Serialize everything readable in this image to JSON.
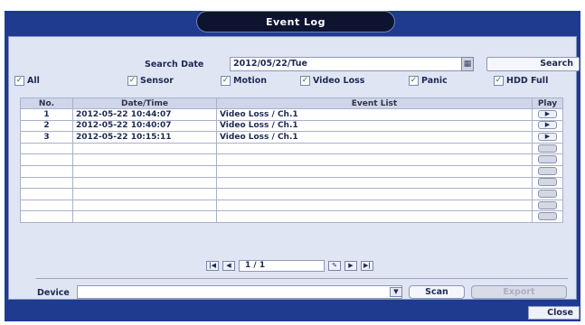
{
  "window": {
    "title": "Event Log"
  },
  "search": {
    "label": "Search Date",
    "date_value": "2012/05/22/Tue",
    "button_label": "Search",
    "calendar_icon": "calendar-icon"
  },
  "filters": [
    {
      "label": "All",
      "checked": true
    },
    {
      "label": "Sensor",
      "checked": true
    },
    {
      "label": "Motion",
      "checked": true
    },
    {
      "label": "Video Loss",
      "checked": true
    },
    {
      "label": "Panic",
      "checked": true
    },
    {
      "label": "HDD Full",
      "checked": true
    }
  ],
  "table": {
    "headers": {
      "no": "No.",
      "datetime": "Date/Time",
      "event": "Event List",
      "play": "Play"
    },
    "rows": [
      {
        "no": "1",
        "datetime": "2012-05-22 10:44:07",
        "event": "Video Loss  / Ch.1"
      },
      {
        "no": "2",
        "datetime": "2012-05-22 10:40:07",
        "event": "Video Loss  / Ch.1"
      },
      {
        "no": "3",
        "datetime": "2012-05-22 10:15:11",
        "event": "Video Loss  / Ch.1"
      }
    ],
    "empty_rows": 7
  },
  "pager": {
    "value": "1 / 1"
  },
  "device": {
    "label": "Device",
    "value": ""
  },
  "buttons": {
    "scan": "Scan",
    "export": "Export",
    "close": "Close"
  },
  "colors": {
    "frame": "#1f3b8f",
    "panel": "#dfe5f3",
    "title_pill": "#0e1430"
  }
}
